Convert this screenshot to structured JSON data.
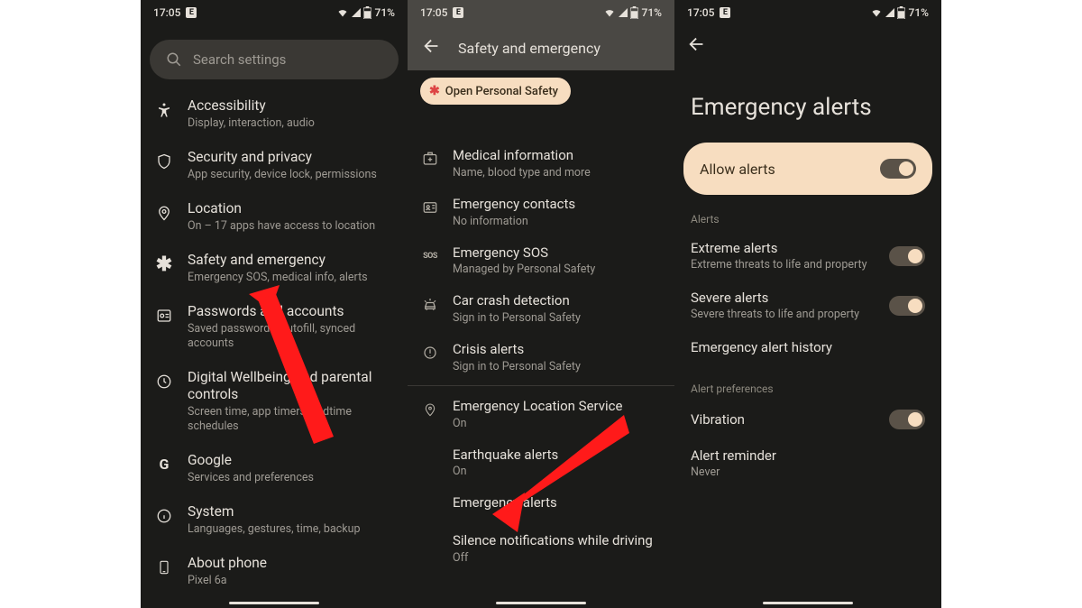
{
  "status": {
    "time": "17:05",
    "battery": "71%"
  },
  "screen1": {
    "search_placeholder": "Search settings",
    "items": [
      {
        "id": "accessibility",
        "title": "Accessibility",
        "sub": "Display, interaction, audio"
      },
      {
        "id": "security-privacy",
        "title": "Security and privacy",
        "sub": "App security, device lock, permissions"
      },
      {
        "id": "location",
        "title": "Location",
        "sub": "On – 17 apps have access to location"
      },
      {
        "id": "safety-emergency",
        "title": "Safety and emergency",
        "sub": "Emergency SOS, medical info, alerts"
      },
      {
        "id": "passwords-accounts",
        "title": "Passwords and accounts",
        "sub": "Saved passwords, autofill, synced accounts"
      },
      {
        "id": "digital-wellbeing",
        "title": "Digital Wellbeing and parental controls",
        "sub": "Screen time, app timers, bedtime schedules"
      },
      {
        "id": "google",
        "title": "Google",
        "sub": "Services and preferences"
      },
      {
        "id": "system",
        "title": "System",
        "sub": "Languages, gestures, time, backup"
      },
      {
        "id": "about-phone",
        "title": "About phone",
        "sub": "Pixel 6a"
      }
    ]
  },
  "screen2": {
    "header": "Safety and emergency",
    "open_chip": "Open Personal Safety",
    "items_a": [
      {
        "id": "medical-info",
        "title": "Medical information",
        "sub": "Name, blood type and more"
      },
      {
        "id": "emergency-contacts",
        "title": "Emergency contacts",
        "sub": "No information"
      },
      {
        "id": "emergency-sos",
        "title": "Emergency SOS",
        "sub": "Managed by Personal Safety"
      },
      {
        "id": "car-crash",
        "title": "Car crash detection",
        "sub": "Sign in to Personal Safety"
      },
      {
        "id": "crisis-alerts",
        "title": "Crisis alerts",
        "sub": "Sign in to Personal Safety"
      }
    ],
    "items_b": [
      {
        "id": "els",
        "title": "Emergency Location Service",
        "sub": "On"
      },
      {
        "id": "earthquake",
        "title": "Earthquake alerts",
        "sub": "On"
      },
      {
        "id": "emergency-alerts",
        "title": "Emergency alerts",
        "sub": ""
      },
      {
        "id": "silence-driving",
        "title": "Silence notifications while driving",
        "sub": "Off"
      }
    ]
  },
  "screen3": {
    "page_title": "Emergency alerts",
    "allow_label": "Allow alerts",
    "section_alerts": "Alerts",
    "alerts": [
      {
        "id": "extreme",
        "title": "Extreme alerts",
        "sub": "Extreme threats to life and property",
        "toggle": true
      },
      {
        "id": "severe",
        "title": "Severe alerts",
        "sub": "Severe threats to life and property",
        "toggle": true
      },
      {
        "id": "history",
        "title": "Emergency alert history",
        "sub": ""
      }
    ],
    "section_prefs": "Alert preferences",
    "prefs": [
      {
        "id": "vibration",
        "title": "Vibration",
        "sub": "",
        "toggle": true
      },
      {
        "id": "reminder",
        "title": "Alert reminder",
        "sub": "Never"
      }
    ]
  }
}
